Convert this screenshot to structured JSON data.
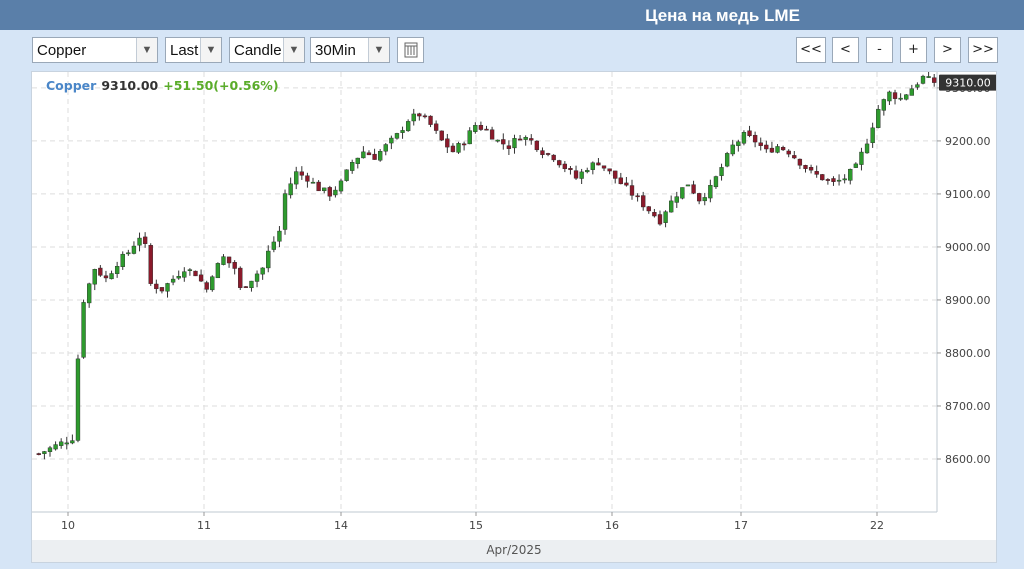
{
  "header": {
    "title": "Цена на медь LME"
  },
  "toolbar": {
    "symbol": "Copper",
    "price_type": "Last",
    "chart_style": "Candle",
    "interval": "30Min",
    "nav_buttons": [
      "<<",
      "<",
      "-",
      "+",
      ">",
      ">>"
    ]
  },
  "icons": {
    "table": "table-icon"
  },
  "colors": {
    "up": "#2e9a2e",
    "down": "#8b1a2b",
    "accent": "#5a7fa9",
    "name": "#4a86c8",
    "change": "#5aac2a"
  },
  "quote": {
    "name": "Copper",
    "price": "9310.00",
    "change": "+51.50(+0.56%)"
  },
  "chart_data": {
    "type": "candlestick",
    "symbol": "Copper",
    "last_price": 9310.0,
    "last_price_label": "9310.00",
    "y_ticks": [
      "8600.00",
      "8700.00",
      "8800.00",
      "8900.00",
      "9000.00",
      "9100.00",
      "9200.00",
      "9300.00"
    ],
    "ylim": [
      8500,
      9330
    ],
    "x_ticks": [
      "10",
      "11",
      "14",
      "15",
      "16",
      "17",
      "22"
    ],
    "xlabel": "Apr/2025",
    "grid": true,
    "close_path": [
      [
        0,
        8610
      ],
      [
        4,
        8630
      ],
      [
        6,
        8640
      ],
      [
        7,
        8790
      ],
      [
        8,
        8900
      ],
      [
        10,
        8960
      ],
      [
        12,
        8940
      ],
      [
        14,
        8970
      ],
      [
        16,
        8990
      ],
      [
        18,
        9020
      ],
      [
        19,
        9000
      ],
      [
        20,
        8930
      ],
      [
        22,
        8920
      ],
      [
        24,
        8940
      ],
      [
        26,
        8960
      ],
      [
        28,
        8950
      ],
      [
        30,
        8920
      ],
      [
        31,
        8950
      ],
      [
        33,
        8980
      ],
      [
        35,
        8960
      ],
      [
        36,
        8920
      ],
      [
        38,
        8940
      ],
      [
        40,
        8960
      ],
      [
        41,
        8990
      ],
      [
        43,
        9030
      ],
      [
        44,
        9100
      ],
      [
        46,
        9140
      ],
      [
        48,
        9130
      ],
      [
        50,
        9110
      ],
      [
        52,
        9100
      ],
      [
        54,
        9120
      ],
      [
        56,
        9160
      ],
      [
        58,
        9180
      ],
      [
        60,
        9170
      ],
      [
        62,
        9190
      ],
      [
        64,
        9210
      ],
      [
        66,
        9240
      ],
      [
        68,
        9250
      ],
      [
        70,
        9230
      ],
      [
        72,
        9200
      ],
      [
        74,
        9180
      ],
      [
        76,
        9200
      ],
      [
        78,
        9230
      ],
      [
        80,
        9220
      ],
      [
        82,
        9200
      ],
      [
        84,
        9190
      ],
      [
        86,
        9210
      ],
      [
        88,
        9200
      ],
      [
        90,
        9180
      ],
      [
        92,
        9170
      ],
      [
        94,
        9150
      ],
      [
        96,
        9130
      ],
      [
        98,
        9150
      ],
      [
        100,
        9160
      ],
      [
        102,
        9140
      ],
      [
        104,
        9120
      ],
      [
        106,
        9100
      ],
      [
        108,
        9080
      ],
      [
        110,
        9060
      ],
      [
        111,
        9050
      ],
      [
        112,
        9070
      ],
      [
        114,
        9100
      ],
      [
        116,
        9120
      ],
      [
        118,
        9090
      ],
      [
        120,
        9110
      ],
      [
        122,
        9150
      ],
      [
        124,
        9190
      ],
      [
        126,
        9210
      ],
      [
        128,
        9200
      ],
      [
        130,
        9180
      ],
      [
        132,
        9190
      ],
      [
        134,
        9180
      ],
      [
        136,
        9160
      ],
      [
        138,
        9140
      ],
      [
        140,
        9130
      ],
      [
        142,
        9120
      ],
      [
        144,
        9130
      ],
      [
        146,
        9150
      ],
      [
        148,
        9200
      ],
      [
        150,
        9260
      ],
      [
        152,
        9290
      ],
      [
        154,
        9280
      ],
      [
        156,
        9300
      ],
      [
        158,
        9320
      ],
      [
        160,
        9310
      ]
    ]
  }
}
